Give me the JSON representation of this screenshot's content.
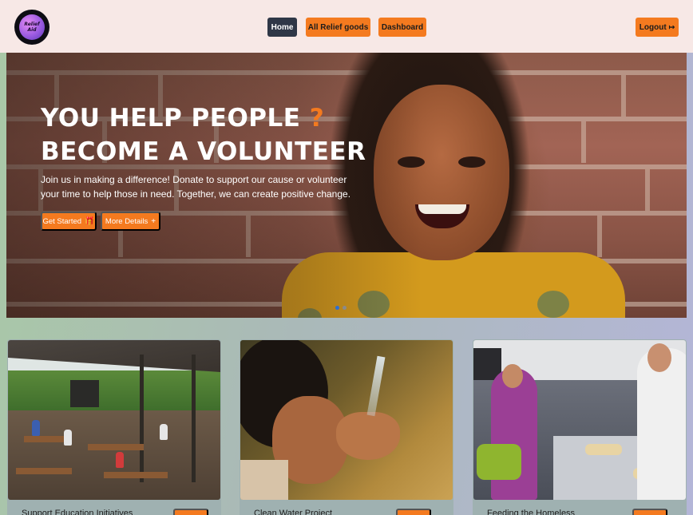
{
  "navbar": {
    "logo_text": "Relief Aid",
    "home_label": "Home",
    "relief_goods_label": "All Relief goods",
    "dashboard_label": "Dashboard",
    "logout_label": "Logout",
    "logout_icon": "logout-icon"
  },
  "hero": {
    "title_line1": "YOU HELP PEOPLE",
    "title_mark": "?",
    "title_line2": "BECOME A VOLUNTEER",
    "description": "Join us in making a difference! Donate to support our cause or volunteer your time to help those in need. Together, we can create positive change.",
    "get_started_label": "Get Started",
    "get_started_icon": "gift-icon",
    "more_details_label": "More Details",
    "more_details_icon": "plus-icon",
    "carousel": {
      "slides": 2,
      "active": 0
    }
  },
  "cards": [
    {
      "title": "Support Education Initiatives",
      "image": "classroom-photo"
    },
    {
      "title": "Clean Water Project",
      "image": "drinking-water-photo"
    },
    {
      "title": "Feeding the Homeless",
      "image": "food-line-photo"
    }
  ],
  "colors": {
    "accent": "#f47a1f",
    "nav_bg": "#f7e8e6",
    "home_button": "#2f3747",
    "carousel_active": "#2d6fd2"
  }
}
